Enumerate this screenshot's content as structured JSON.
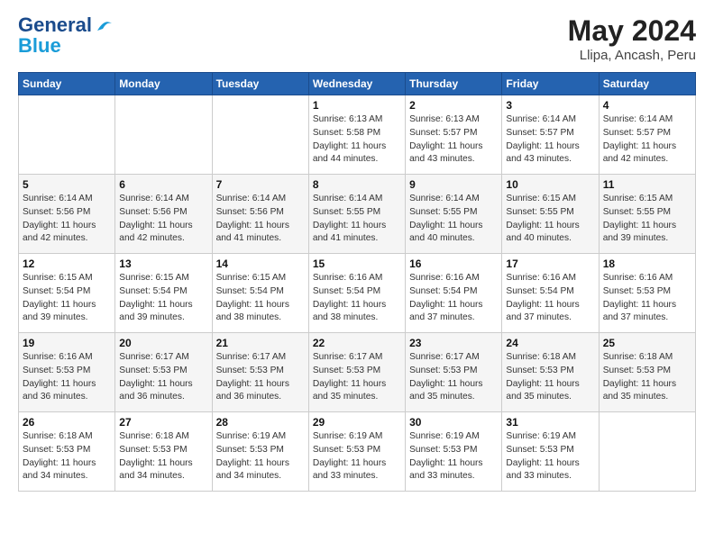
{
  "header": {
    "logo_line1": "General",
    "logo_line2": "Blue",
    "month_year": "May 2024",
    "location": "Llipa, Ancash, Peru"
  },
  "weekdays": [
    "Sunday",
    "Monday",
    "Tuesday",
    "Wednesday",
    "Thursday",
    "Friday",
    "Saturday"
  ],
  "weeks": [
    [
      {
        "day": "",
        "info": ""
      },
      {
        "day": "",
        "info": ""
      },
      {
        "day": "",
        "info": ""
      },
      {
        "day": "1",
        "info": "Sunrise: 6:13 AM\nSunset: 5:58 PM\nDaylight: 11 hours\nand 44 minutes."
      },
      {
        "day": "2",
        "info": "Sunrise: 6:13 AM\nSunset: 5:57 PM\nDaylight: 11 hours\nand 43 minutes."
      },
      {
        "day": "3",
        "info": "Sunrise: 6:14 AM\nSunset: 5:57 PM\nDaylight: 11 hours\nand 43 minutes."
      },
      {
        "day": "4",
        "info": "Sunrise: 6:14 AM\nSunset: 5:57 PM\nDaylight: 11 hours\nand 42 minutes."
      }
    ],
    [
      {
        "day": "5",
        "info": "Sunrise: 6:14 AM\nSunset: 5:56 PM\nDaylight: 11 hours\nand 42 minutes."
      },
      {
        "day": "6",
        "info": "Sunrise: 6:14 AM\nSunset: 5:56 PM\nDaylight: 11 hours\nand 42 minutes."
      },
      {
        "day": "7",
        "info": "Sunrise: 6:14 AM\nSunset: 5:56 PM\nDaylight: 11 hours\nand 41 minutes."
      },
      {
        "day": "8",
        "info": "Sunrise: 6:14 AM\nSunset: 5:55 PM\nDaylight: 11 hours\nand 41 minutes."
      },
      {
        "day": "9",
        "info": "Sunrise: 6:14 AM\nSunset: 5:55 PM\nDaylight: 11 hours\nand 40 minutes."
      },
      {
        "day": "10",
        "info": "Sunrise: 6:15 AM\nSunset: 5:55 PM\nDaylight: 11 hours\nand 40 minutes."
      },
      {
        "day": "11",
        "info": "Sunrise: 6:15 AM\nSunset: 5:55 PM\nDaylight: 11 hours\nand 39 minutes."
      }
    ],
    [
      {
        "day": "12",
        "info": "Sunrise: 6:15 AM\nSunset: 5:54 PM\nDaylight: 11 hours\nand 39 minutes."
      },
      {
        "day": "13",
        "info": "Sunrise: 6:15 AM\nSunset: 5:54 PM\nDaylight: 11 hours\nand 39 minutes."
      },
      {
        "day": "14",
        "info": "Sunrise: 6:15 AM\nSunset: 5:54 PM\nDaylight: 11 hours\nand 38 minutes."
      },
      {
        "day": "15",
        "info": "Sunrise: 6:16 AM\nSunset: 5:54 PM\nDaylight: 11 hours\nand 38 minutes."
      },
      {
        "day": "16",
        "info": "Sunrise: 6:16 AM\nSunset: 5:54 PM\nDaylight: 11 hours\nand 37 minutes."
      },
      {
        "day": "17",
        "info": "Sunrise: 6:16 AM\nSunset: 5:54 PM\nDaylight: 11 hours\nand 37 minutes."
      },
      {
        "day": "18",
        "info": "Sunrise: 6:16 AM\nSunset: 5:53 PM\nDaylight: 11 hours\nand 37 minutes."
      }
    ],
    [
      {
        "day": "19",
        "info": "Sunrise: 6:16 AM\nSunset: 5:53 PM\nDaylight: 11 hours\nand 36 minutes."
      },
      {
        "day": "20",
        "info": "Sunrise: 6:17 AM\nSunset: 5:53 PM\nDaylight: 11 hours\nand 36 minutes."
      },
      {
        "day": "21",
        "info": "Sunrise: 6:17 AM\nSunset: 5:53 PM\nDaylight: 11 hours\nand 36 minutes."
      },
      {
        "day": "22",
        "info": "Sunrise: 6:17 AM\nSunset: 5:53 PM\nDaylight: 11 hours\nand 35 minutes."
      },
      {
        "day": "23",
        "info": "Sunrise: 6:17 AM\nSunset: 5:53 PM\nDaylight: 11 hours\nand 35 minutes."
      },
      {
        "day": "24",
        "info": "Sunrise: 6:18 AM\nSunset: 5:53 PM\nDaylight: 11 hours\nand 35 minutes."
      },
      {
        "day": "25",
        "info": "Sunrise: 6:18 AM\nSunset: 5:53 PM\nDaylight: 11 hours\nand 35 minutes."
      }
    ],
    [
      {
        "day": "26",
        "info": "Sunrise: 6:18 AM\nSunset: 5:53 PM\nDaylight: 11 hours\nand 34 minutes."
      },
      {
        "day": "27",
        "info": "Sunrise: 6:18 AM\nSunset: 5:53 PM\nDaylight: 11 hours\nand 34 minutes."
      },
      {
        "day": "28",
        "info": "Sunrise: 6:19 AM\nSunset: 5:53 PM\nDaylight: 11 hours\nand 34 minutes."
      },
      {
        "day": "29",
        "info": "Sunrise: 6:19 AM\nSunset: 5:53 PM\nDaylight: 11 hours\nand 33 minutes."
      },
      {
        "day": "30",
        "info": "Sunrise: 6:19 AM\nSunset: 5:53 PM\nDaylight: 11 hours\nand 33 minutes."
      },
      {
        "day": "31",
        "info": "Sunrise: 6:19 AM\nSunset: 5:53 PM\nDaylight: 11 hours\nand 33 minutes."
      },
      {
        "day": "",
        "info": ""
      }
    ]
  ]
}
